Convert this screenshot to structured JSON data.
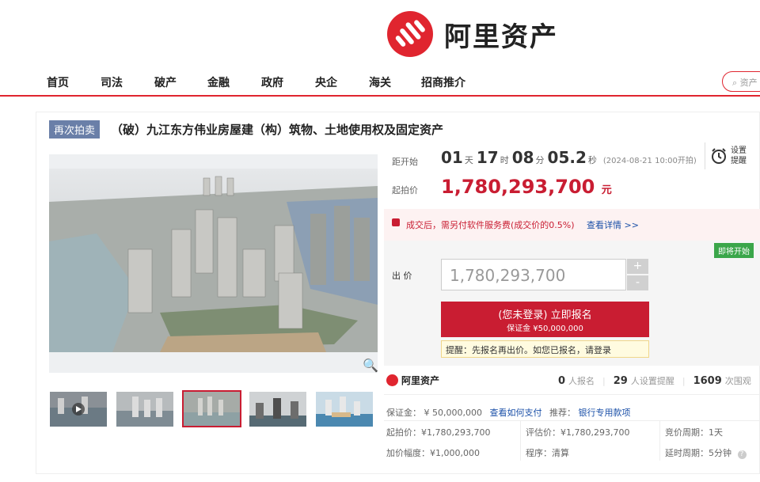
{
  "brand": {
    "name": "阿里资产"
  },
  "nav": {
    "items": [
      "首页",
      "司法",
      "破产",
      "金融",
      "政府",
      "央企",
      "海关",
      "招商推介"
    ]
  },
  "search": {
    "placeholder": "资产"
  },
  "item": {
    "tag": "再次拍卖",
    "title": "（破）九江东方伟业房屋建（构）筑物、土地使用权及固定资产"
  },
  "countdown": {
    "label": "距开始",
    "days": "01",
    "days_unit": "天",
    "hours": "17",
    "hours_unit": "时",
    "minutes": "08",
    "minutes_unit": "分",
    "seconds": "05.2",
    "seconds_unit": "秒",
    "start_note": "(2024-08-21 10:00开拍)"
  },
  "reminder": {
    "line1": "设置",
    "line2": "提醒"
  },
  "start_price": {
    "label": "起拍价",
    "value": "1,780,293,700",
    "unit": "元"
  },
  "service_notice": {
    "text": "成交后，需另付软件服务费(成交价的0.5%)",
    "link": "查看详情 >>"
  },
  "bid": {
    "badge": "即将开始",
    "label": "出 价",
    "value": "1,780,293,700",
    "plus": "+",
    "minus": "-",
    "signup_title": "(您未登录) 立即报名",
    "signup_sub": "保证金 ¥50,000,000",
    "hint": "提醒：先报名再出价。如您已报名，请登录"
  },
  "stats": {
    "brand": "阿里资产",
    "signups": "0",
    "signups_label": "人报名",
    "reminders": "29",
    "reminders_label": "人设置提醒",
    "views": "1609",
    "views_label": "次围观"
  },
  "details": {
    "deposit_label": "保证金：",
    "deposit_value": "¥ 50,000,000",
    "how_pay": "查看如何支付",
    "recommend_label": "推荐：",
    "recommend_link": "银行专用款项",
    "start_price": "起拍价：¥1,780,293,700",
    "appraisal": "评估价：¥1,780,293,700",
    "cycle": "竞价周期：1天",
    "increment": "加价幅度：¥1,000,000",
    "procedure": "程序：清算",
    "delay": "延时周期：5分钟"
  },
  "icons": {
    "zoom": "magnifier-icon",
    "reminder": "alarm-clock-icon",
    "help": "question-icon",
    "play": "play-icon",
    "notice": "notice-icon"
  },
  "colors": {
    "brand_red": "#c91d32",
    "tag_blue": "#6a7fa8",
    "green": "#3aa64a"
  }
}
